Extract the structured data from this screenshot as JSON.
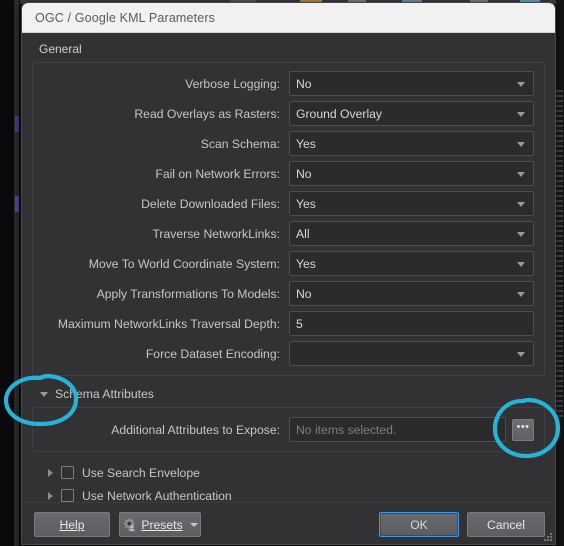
{
  "window": {
    "title": "OGC / Google KML Parameters"
  },
  "section": {
    "title": "General"
  },
  "general_rows": [
    {
      "label": "Verbose Logging:",
      "value": "No",
      "control": "combo"
    },
    {
      "label": "Read Overlays as Rasters:",
      "value": "Ground Overlay",
      "control": "combo"
    },
    {
      "label": "Scan Schema:",
      "value": "Yes",
      "control": "combo"
    },
    {
      "label": "Fail on Network Errors:",
      "value": "No",
      "control": "combo"
    },
    {
      "label": "Delete Downloaded Files:",
      "value": "Yes",
      "control": "combo"
    },
    {
      "label": "Traverse NetworkLinks:",
      "value": "All",
      "control": "combo"
    },
    {
      "label": "Move To World Coordinate System:",
      "value": "Yes",
      "control": "combo"
    },
    {
      "label": "Apply Transformations To Models:",
      "value": "No",
      "control": "combo"
    },
    {
      "label": "Maximum NetworkLinks Traversal Depth:",
      "value": "5",
      "control": "text"
    },
    {
      "label": "Force Dataset Encoding:",
      "value": "",
      "control": "combo"
    }
  ],
  "schema": {
    "header": "Schema Attributes",
    "attributes_label": "Additional Attributes to Expose:",
    "attributes_placeholder": "No items selected.",
    "browse_label": "•••"
  },
  "checkboxes": [
    {
      "label": "Use Search Envelope",
      "checked": false
    },
    {
      "label": "Use Network Authentication",
      "checked": false
    }
  ],
  "buttons": {
    "help": "Help",
    "presets": "Presets",
    "ok": "OK",
    "cancel": "Cancel"
  },
  "colors": {
    "annotation": "#25b4d8",
    "focus_ring": "#3d9ae8",
    "titlebar_bg": "#f1f1f1",
    "dialog_bg": "#323234",
    "field_bg": "#2b2b2d"
  },
  "annotations": [
    {
      "name": "circle-schema-attributes"
    },
    {
      "name": "circle-browse-button"
    }
  ]
}
